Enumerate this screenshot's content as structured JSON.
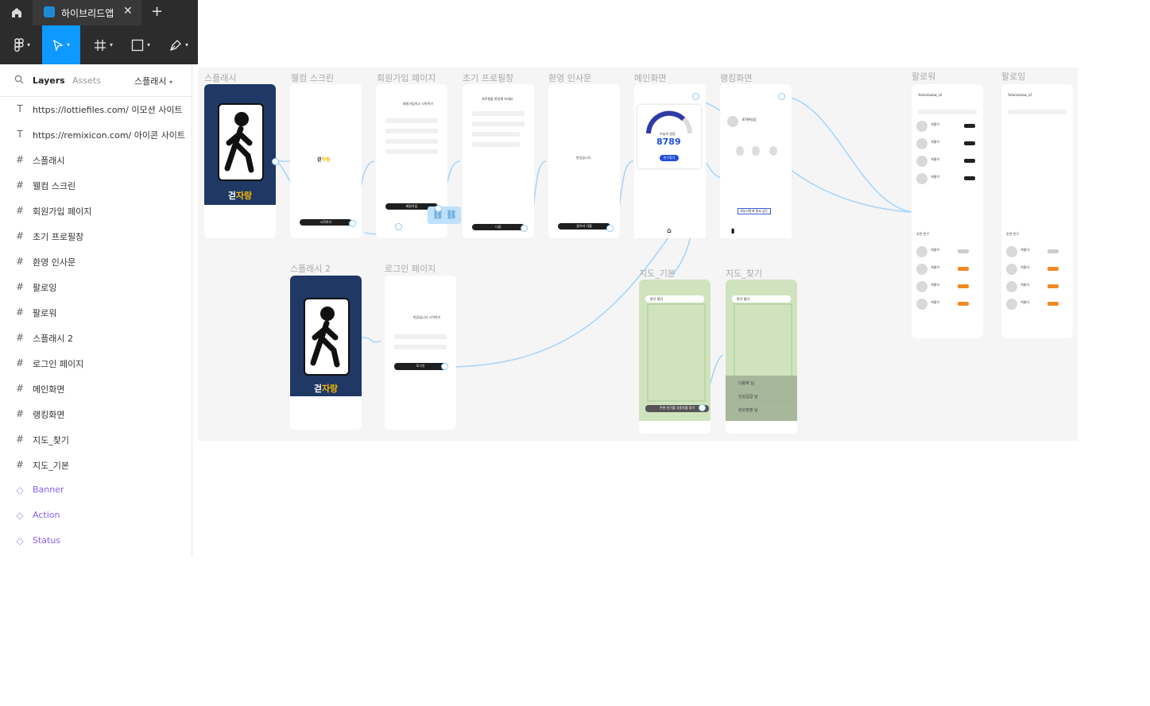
{
  "app": {
    "home_icon": "home-icon",
    "file_tab": {
      "title": "하이브리드앱",
      "close": "✕"
    },
    "new_tab": "+"
  },
  "toolbar": {
    "tools": [
      "main-menu",
      "move-tool",
      "frame-tool",
      "shape-tool",
      "pen-tool"
    ],
    "active": "move-tool"
  },
  "sidebar": {
    "tab_layers": "Layers",
    "tab_assets": "Assets",
    "page_name": "스플래시",
    "layers": [
      {
        "type": "text",
        "label": "https://lottiefiles.com/ 이모션 사이트"
      },
      {
        "type": "text",
        "label": "https://remixicon.com/ 아이콘 사이트"
      },
      {
        "type": "frame",
        "label": "스플래시"
      },
      {
        "type": "frame",
        "label": "웰컴 스크린"
      },
      {
        "type": "frame",
        "label": "회원가입 페이지"
      },
      {
        "type": "frame",
        "label": "초기 프로필창"
      },
      {
        "type": "frame",
        "label": "환영 인사문"
      },
      {
        "type": "frame",
        "label": "팔로잉"
      },
      {
        "type": "frame",
        "label": "팔로워"
      },
      {
        "type": "frame",
        "label": "스플래시 2"
      },
      {
        "type": "frame",
        "label": "로그인 페이지"
      },
      {
        "type": "frame",
        "label": "메인화면"
      },
      {
        "type": "frame",
        "label": "랭킹화면"
      },
      {
        "type": "frame",
        "label": "지도_찾기"
      },
      {
        "type": "frame",
        "label": "지도_기본"
      },
      {
        "type": "component",
        "label": "Banner"
      },
      {
        "type": "component",
        "label": "Action"
      },
      {
        "type": "component",
        "label": "Status"
      }
    ]
  },
  "canvas": {
    "frames": {
      "splash": "스플래시",
      "welcome": "웰컴 스크린",
      "signup": "회원가입 페이지",
      "profile": "초기 프로필창",
      "greeting": "환영 인사문",
      "main": "메인화면",
      "ranking": "랭킹화면",
      "follower": "팔로워",
      "following": "팔로잉",
      "splash2": "스플래시 2",
      "login": "로그인 페이지",
      "map_basic": "지도_기본",
      "map_find": "지도_찾기"
    },
    "app_name": "걷자랑",
    "app_name_first": "걷",
    "app_name_rest": "자랑",
    "welcome_start": "시작하기",
    "signup_title": "회원가입하고\n시작하기",
    "signup_button": "회원가입",
    "profile_title": "프로필을 완성해 보세요",
    "profile_next": "다음",
    "greeting_title": "반갑습니다",
    "greeting_button": "걸으러 가볼",
    "main_label": "오늘의 걸음",
    "main_steps": "8789",
    "main_button": "친구찾기",
    "ranking_user_line": "8789걸음",
    "ranking_button": "세부사항에 필요 없는",
    "account": "Yuheniaoow_s2",
    "friend_name": "겨울이",
    "recommended": "추천 친구",
    "follow_label": "팔로우",
    "delete_label": "삭제",
    "login_title": "반갑습니다\n시작하기",
    "login_button": "로그인",
    "map_search": "친구 찾기",
    "map_bottom_button": "주변 친구를 사용자를 찾기",
    "map_users": [
      "다람쥐 님",
      "인김걸걸 님",
      "완오방영 님"
    ]
  }
}
